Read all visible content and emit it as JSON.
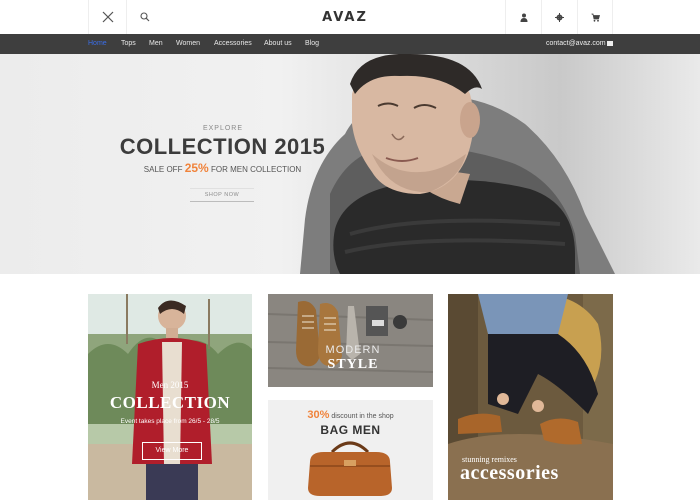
{
  "header": {
    "logo": "AVAZ",
    "icons": [
      "close-icon",
      "search-icon",
      "user-icon",
      "gear-icon",
      "cart-icon"
    ]
  },
  "nav": {
    "items": [
      "Home",
      "Tops",
      "Men",
      "Women",
      "Accessories",
      "About us",
      "Blog"
    ],
    "active_index": 0,
    "contact": "contact@avaz.com"
  },
  "hero": {
    "explore": "EXPLORE",
    "title": "COLLECTION 2015",
    "sale_prefix": "SALE OFF",
    "sale_percent": "25%",
    "sale_suffix": "FOR MEN COLLECTION",
    "button": "SHOP NOW"
  },
  "cards": {
    "men": {
      "subtitle": "Men 2015",
      "title": "COLLECTION",
      "event": "Event takes place from 26/5 - 28/5",
      "button": "View More"
    },
    "style": {
      "line1": "MODERN",
      "line2": "STYLE"
    },
    "bag": {
      "percent": "30%",
      "text": "discount in the shop",
      "title": "BAG MEN"
    },
    "accessories": {
      "subtitle": "stunning remixes",
      "title": "accessories"
    }
  },
  "colors": {
    "accent": "#f0833b",
    "nav_bg": "#3e3e3e",
    "active_nav": "#3a6ee8"
  }
}
